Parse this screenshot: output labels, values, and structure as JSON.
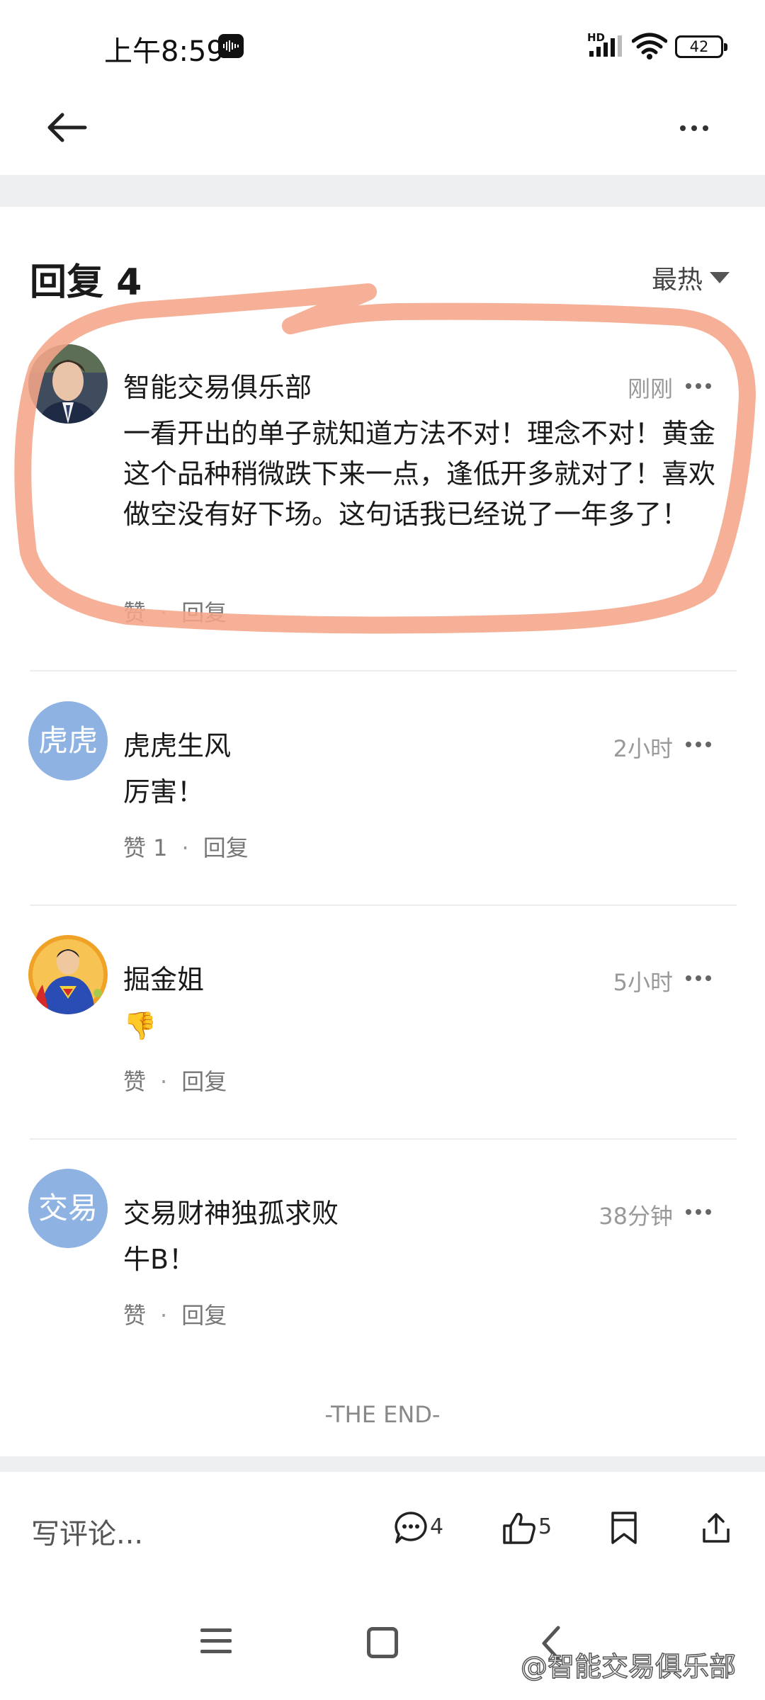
{
  "status_bar": {
    "time": "上午8:59",
    "network": "HD",
    "battery": "42"
  },
  "header": {
    "title": "回复 4",
    "sort_label": "最热"
  },
  "comments": [
    {
      "name": "智能交易俱乐部",
      "time": "刚刚",
      "text": "一看开出的单子就知道方法不对！理念不对！黄金这个品种稍微跌下来一点，逢低开多就对了！喜欢做空没有好下场。这句话我已经说了一年多了！",
      "like_label": "赞",
      "reply_label": "回复",
      "avatar": "photo-avatar"
    },
    {
      "name": "虎虎生风",
      "time": "2小时",
      "text": "厉害！",
      "like_label": "赞 1",
      "reply_label": "回复",
      "avatar_text": "虎虎"
    },
    {
      "name": "掘金姐",
      "time": "5小时",
      "text": "👎",
      "like_label": "赞",
      "reply_label": "回复",
      "avatar": "superman-avatar"
    },
    {
      "name": "交易财神独孤求败",
      "time": "38分钟",
      "text": "牛B！",
      "like_label": "赞",
      "reply_label": "回复",
      "avatar_text": "交易"
    }
  ],
  "end_text": "-THE END-",
  "bottom_bar": {
    "write_comment": "写评论...",
    "comment_count": "4",
    "like_count": "5"
  },
  "watermark": "@智能交易俱乐部",
  "colors": {
    "avatar_bg": "#8eb3e3",
    "highlight": "#f5a589",
    "divider": "#eeeeee"
  }
}
